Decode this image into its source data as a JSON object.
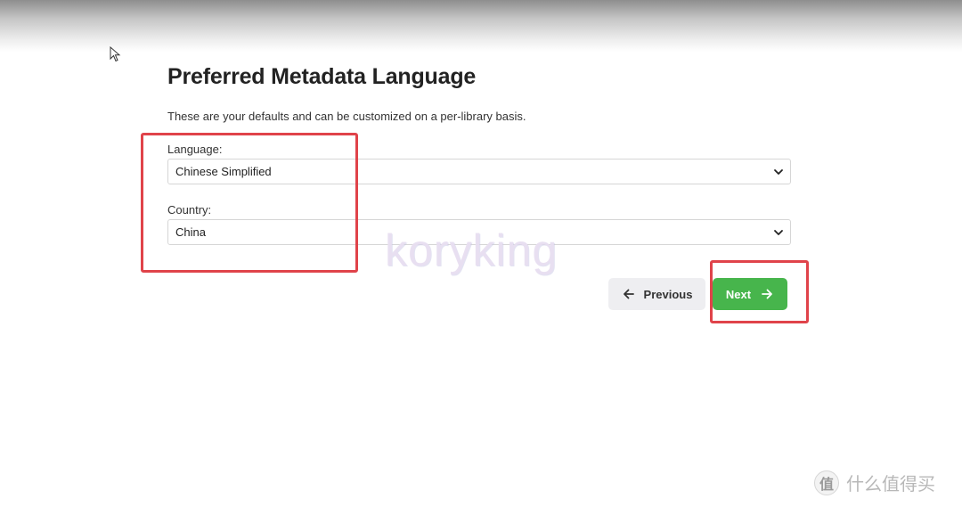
{
  "page": {
    "title": "Preferred Metadata Language",
    "subtitle": "These are your defaults and can be customized on a per-library basis."
  },
  "fields": {
    "language": {
      "label": "Language:",
      "value": "Chinese Simplified"
    },
    "country": {
      "label": "Country:",
      "value": "China"
    }
  },
  "buttons": {
    "previous": "Previous",
    "next": "Next"
  },
  "overlay": {
    "watermark": "koryking",
    "logo_glyph": "值",
    "logo_text": "什么值得买",
    "annotation_color": "#e0434a"
  },
  "colors": {
    "primary_button": "#47b54c",
    "secondary_button": "#eeeef1"
  },
  "icons": {
    "cursor": "mouse-pointer-icon",
    "select_indicator": "chevron-down-icon",
    "previous": "arrow-left-icon",
    "next": "arrow-right-icon"
  }
}
